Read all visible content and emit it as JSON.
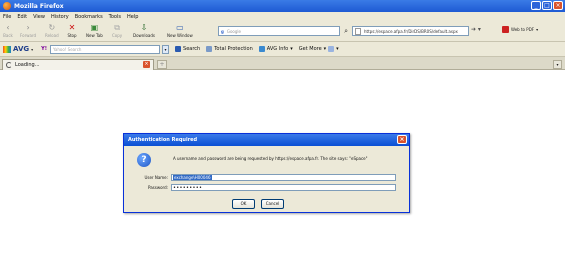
{
  "window": {
    "title": "Mozilla Firefox"
  },
  "menu": [
    "File",
    "Edit",
    "View",
    "History",
    "Bookmarks",
    "Tools",
    "Help"
  ],
  "nav": {
    "back": "Back",
    "forward": "Forward",
    "reload": "Reload",
    "stop": "Stop",
    "new_tab": "New Tab",
    "copy": "Copy",
    "downloads": "Downloads",
    "new_window": "New Window",
    "search_engine": "Google",
    "search_placeholder": "",
    "url": "https://espace.afpa.fr/DirDS/BR0S/default.aspx",
    "web_to_pdf": "Web to PDF"
  },
  "avg": {
    "logo": "AVG",
    "yahoo": "Y!",
    "search_placeholder": "Yahoo! Search",
    "items": [
      "Search",
      "Total Protection",
      "AVG Info",
      "Get More"
    ]
  },
  "tab": {
    "label": "Loading..."
  },
  "dialog": {
    "title": "Authentication Required",
    "message": "A username and password are being requested by https://espace.afpa.fr. The site says: \"eSpace\"",
    "user_label": "User Name:",
    "user_value": "exchange\\H00046",
    "password_label": "Password:",
    "password_mask": "•••••••••",
    "ok_label": "OK",
    "cancel_label": "Cancel"
  }
}
